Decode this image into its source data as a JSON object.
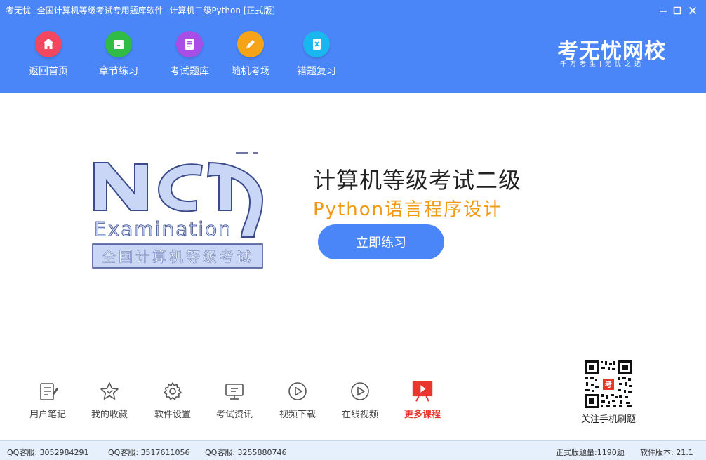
{
  "window": {
    "title": "考无忧--全国计算机等级考试专用题库软件--计算机二级Python [正式版]",
    "minimize_label": "—",
    "close_label": "✕"
  },
  "nav": {
    "items": [
      {
        "label": "返回首页",
        "icon": "home-icon",
        "color": "#f2475e"
      },
      {
        "label": "章节练习",
        "icon": "folder-icon",
        "color": "#2fbb46"
      },
      {
        "label": "考试题库",
        "icon": "document-icon",
        "color": "#a84ee6"
      },
      {
        "label": "随机考场",
        "icon": "pencil-icon",
        "color": "#f7a317"
      },
      {
        "label": "错题复习",
        "icon": "wrong-review-icon",
        "color": "#19b6f0"
      }
    ]
  },
  "brand": {
    "name": "考无忧网校",
    "slogan": "千万考生|无忧之选"
  },
  "hero": {
    "logo_letters": "NCR",
    "logo_word": "Examination",
    "logo_caption": "全国计算机等级考试",
    "title": "计算机等级考试二级",
    "subtitle": "Python语言程序设计",
    "start_label": "立即练习",
    "accent": "#4a86f7",
    "subtitle_color": "#f19a14"
  },
  "tools": [
    {
      "label": "用户笔记",
      "icon": "notebook-icon"
    },
    {
      "label": "我的收藏",
      "icon": "star-icon"
    },
    {
      "label": "软件设置",
      "icon": "gear-icon"
    },
    {
      "label": "考试资讯",
      "icon": "monitor-icon"
    },
    {
      "label": "视频下载",
      "icon": "play-circle-icon"
    },
    {
      "label": "在线视频",
      "icon": "play-circle-icon"
    },
    {
      "label": "更多课程",
      "icon": "course-board-icon",
      "color": "#e8372c"
    }
  ],
  "qr": {
    "caption": "关注手机刷题"
  },
  "status": {
    "qq1": "QQ客服: 3052984291",
    "qq2": "QQ客服: 3517611056",
    "qq3": "QQ客服: 3255880746",
    "question_count": "正式版题量:1190题",
    "version": "软件版本: 21.1"
  }
}
